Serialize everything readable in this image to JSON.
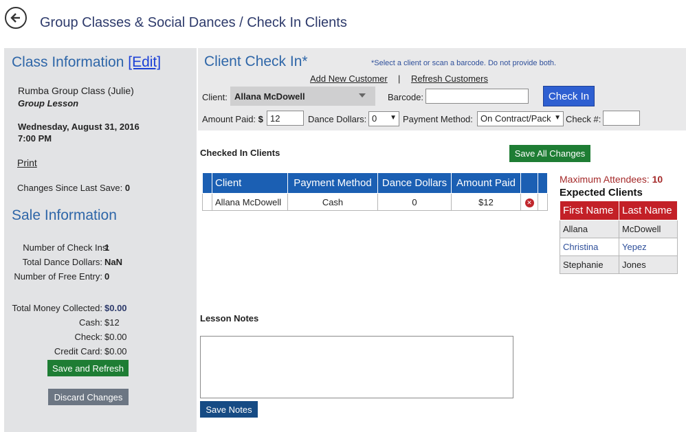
{
  "header": {
    "title": "Group Classes & Social Dances / Check In Clients",
    "back_icon": "back-arrow-icon"
  },
  "sidebar": {
    "class_info_title": "Class Information",
    "edit_label": "[Edit]",
    "class_name": "Rumba Group Class (Julie)",
    "class_type": "Group Lesson",
    "date": "Wednesday, August 31, 2016",
    "time": "7:00 PM",
    "print_label": "Print",
    "changes_label": "Changes Since Last Save:",
    "changes_value": "0",
    "sale_info_title": "Sale Information",
    "check_ins_label": "Number of Check Ins:",
    "check_ins_value": "1",
    "dance_dollars_label": "Total Dance Dollars:",
    "dance_dollars_value": "NaN",
    "free_entry_label": "Number of Free Entry:",
    "free_entry_value": "0",
    "total_money_label": "Total Money Collected:",
    "total_money_value": "$0.00",
    "cash_label": "Cash:",
    "cash_value": "$12",
    "check_label": "Check:",
    "check_value": "$0.00",
    "credit_label": "Credit Card:",
    "credit_value": "$0.00",
    "save_refresh_label": "Save and Refresh",
    "discard_label": "Discard Changes"
  },
  "checkin": {
    "title": "Client Check In*",
    "hint": "*Select a client or scan a barcode. Do not provide both.",
    "add_customer_label": "Add New Customer",
    "separator": "|",
    "refresh_customers_label": "Refresh Customers",
    "client_label": "Client:",
    "client_value": "Allana McDowell",
    "barcode_label": "Barcode:",
    "barcode_value": "",
    "check_in_label": "Check In",
    "amount_paid_label": "Amount Paid:",
    "dollar_sign": "$",
    "amount_paid_value": "12",
    "dance_dollars_label": "Dance Dollars:",
    "dance_dollars_value": "0",
    "payment_method_label": "Payment Method:",
    "payment_method_value": "On Contract/Pack",
    "check_num_label": "Check #:",
    "check_num_value": ""
  },
  "checked_in": {
    "title": "Checked In Clients",
    "save_all_label": "Save All Changes",
    "columns": [
      "Client",
      "Payment Method",
      "Dance Dollars",
      "Amount Paid"
    ],
    "rows": [
      {
        "client": "Allana McDowell",
        "payment_method": "Cash",
        "dance_dollars": "0",
        "amount_paid": "$12"
      }
    ]
  },
  "expected": {
    "max_label": "Maximum Attendees:",
    "max_value": "10",
    "title": "Expected Clients",
    "columns": [
      "First Name",
      "Last Name"
    ],
    "rows": [
      {
        "first": "Allana",
        "last": "McDowell"
      },
      {
        "first": "Christina",
        "last": "Yepez"
      },
      {
        "first": "Stephanie",
        "last": "Jones"
      }
    ]
  },
  "notes": {
    "title": "Lesson Notes",
    "value": "",
    "save_label": "Save Notes"
  },
  "colors": {
    "accent_blue": "#1b5fb3",
    "brand_red": "#c32027",
    "save_green": "#1e7d34",
    "navy": "#164b84"
  }
}
